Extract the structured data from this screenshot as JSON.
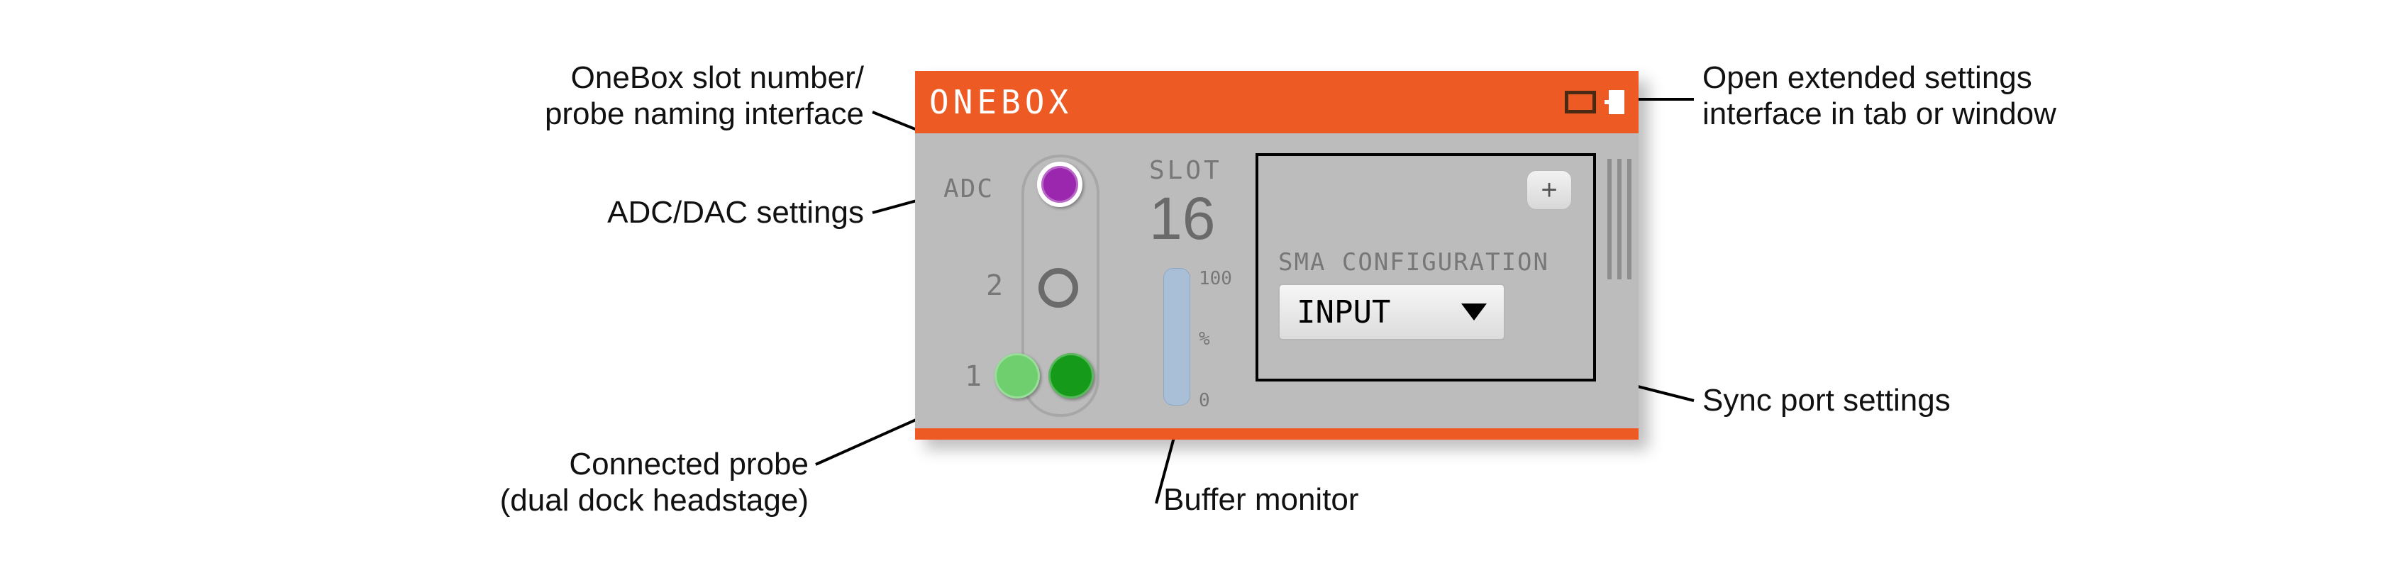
{
  "panel": {
    "title": "ONEBOX",
    "adc_label": "ADC",
    "slot_label": "SLOT",
    "slot_number": "16",
    "ports": {
      "p1_number": "1",
      "p2_number": "2"
    },
    "buffer": {
      "top_tick": "100",
      "unit": "%",
      "bottom_tick": "0"
    },
    "sma": {
      "group_label": "SMA CONFIGURATION",
      "add_icon": "+",
      "selected_option": "INPUT"
    }
  },
  "annotations": {
    "slot_naming": "OneBox slot number/\nprobe naming interface",
    "adc_dac": "ADC/DAC settings",
    "probe": "Connected probe\n(dual dock headstage)",
    "open_ext": "Open extended settings\ninterface in tab or window",
    "sync": "Sync port settings",
    "buffer": "Buffer monitor"
  }
}
